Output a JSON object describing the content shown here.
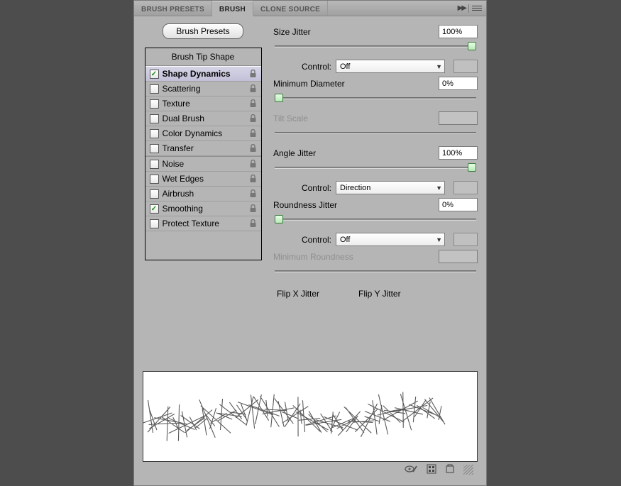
{
  "tabs": {
    "presets": "BRUSH PRESETS",
    "brush": "BRUSH",
    "clone": "CLONE SOURCE"
  },
  "presets_button": "Brush Presets",
  "options_header": "Brush Tip Shape",
  "options": [
    {
      "label": "Shape Dynamics",
      "checked": true,
      "selected": true,
      "lock": true
    },
    {
      "label": "Scattering",
      "checked": false,
      "selected": false,
      "lock": true
    },
    {
      "label": "Texture",
      "checked": false,
      "selected": false,
      "lock": true
    },
    {
      "label": "Dual Brush",
      "checked": false,
      "selected": false,
      "lock": true
    },
    {
      "label": "Color Dynamics",
      "checked": false,
      "selected": false,
      "lock": true
    },
    {
      "label": "Transfer",
      "checked": false,
      "selected": false,
      "lock": true
    }
  ],
  "options2": [
    {
      "label": "Noise",
      "checked": false,
      "lock": true
    },
    {
      "label": "Wet Edges",
      "checked": false,
      "lock": true
    },
    {
      "label": "Airbrush",
      "checked": false,
      "lock": true
    },
    {
      "label": "Smoothing",
      "checked": true,
      "lock": true
    },
    {
      "label": "Protect Texture",
      "checked": false,
      "lock": true
    }
  ],
  "settings": {
    "size_jitter": {
      "label": "Size Jitter",
      "value": "100%",
      "slider": 100
    },
    "size_control": {
      "label": "Control:",
      "value": "Off"
    },
    "min_diameter": {
      "label": "Minimum Diameter",
      "value": "0%",
      "slider": 0
    },
    "tilt_scale": {
      "label": "Tilt Scale",
      "disabled": true
    },
    "angle_jitter": {
      "label": "Angle Jitter",
      "value": "100%",
      "slider": 100
    },
    "angle_control": {
      "label": "Control:",
      "value": "Direction"
    },
    "round_jitter": {
      "label": "Roundness Jitter",
      "value": "0%",
      "slider": 0
    },
    "round_control": {
      "label": "Control:",
      "value": "Off"
    },
    "min_round": {
      "label": "Minimum Roundness",
      "disabled": true
    },
    "flipx": {
      "label": "Flip X Jitter",
      "checked": true
    },
    "flipy": {
      "label": "Flip Y Jitter",
      "checked": true
    }
  }
}
